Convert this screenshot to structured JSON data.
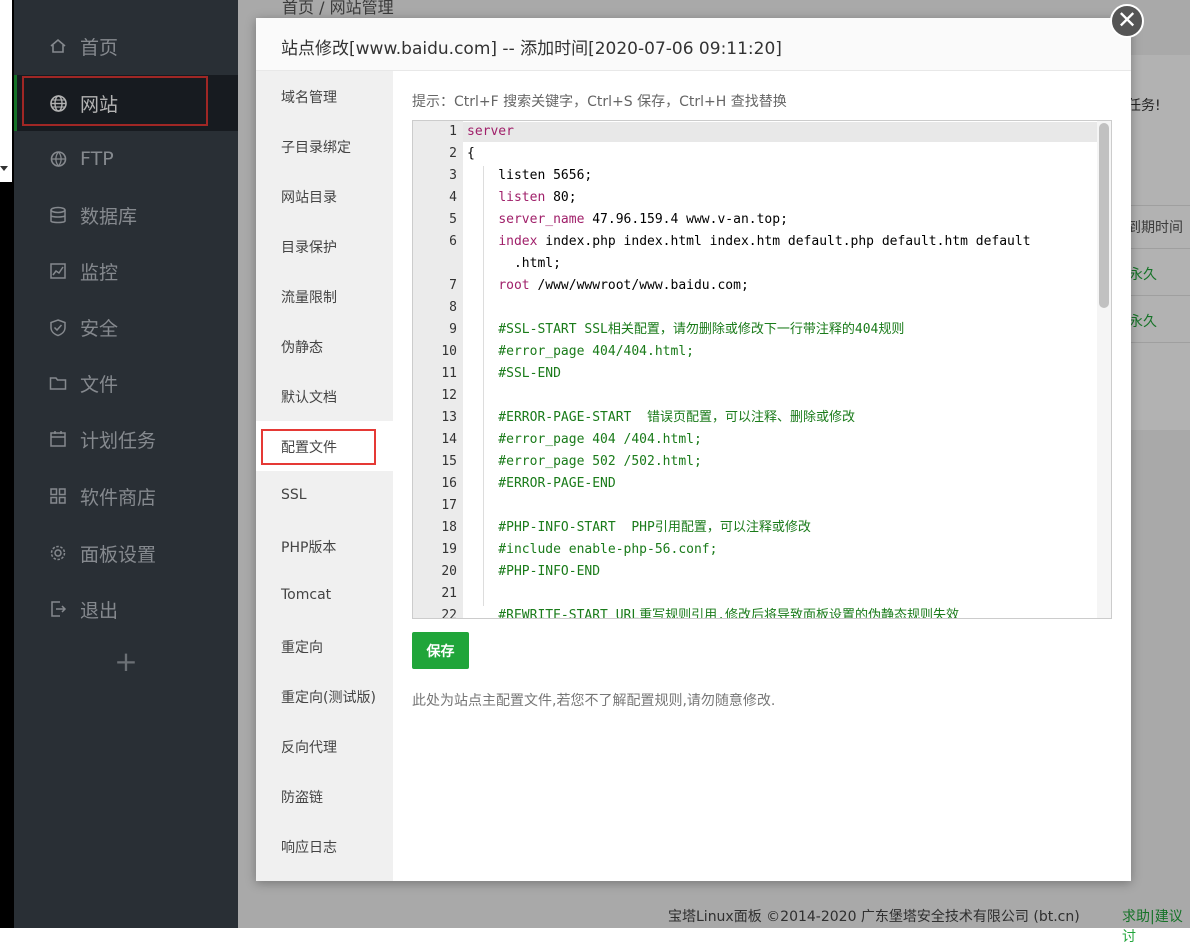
{
  "sidebar": {
    "items": [
      {
        "label": "首页",
        "icon": "home-icon"
      },
      {
        "label": "网站",
        "icon": "globe-icon",
        "active": true
      },
      {
        "label": "FTP",
        "icon": "ftp-icon"
      },
      {
        "label": "数据库",
        "icon": "database-icon"
      },
      {
        "label": "监控",
        "icon": "monitor-icon"
      },
      {
        "label": "安全",
        "icon": "shield-icon"
      },
      {
        "label": "文件",
        "icon": "folder-icon"
      },
      {
        "label": "计划任务",
        "icon": "calendar-icon"
      },
      {
        "label": "软件商店",
        "icon": "grid-icon"
      },
      {
        "label": "面板设置",
        "icon": "gear-icon"
      },
      {
        "label": "退出",
        "icon": "logout-icon"
      }
    ],
    "add_label": "+"
  },
  "background": {
    "breadcrumb": "首页 / 网站管理",
    "task_text": "任务!",
    "expire_header": "到期时间",
    "row1_expire": "永久",
    "row2_expire": "永久"
  },
  "modal": {
    "title": "站点修改[www.baidu.com] -- 添加时间[2020-07-06 09:11:20]",
    "close_label": "✕",
    "tabs": [
      "域名管理",
      "子目录绑定",
      "网站目录",
      "目录保护",
      "流量限制",
      "伪静态",
      "默认文档",
      "配置文件",
      "SSL",
      "PHP版本",
      "Tomcat",
      "重定向",
      "重定向(测试版)",
      "反向代理",
      "防盗链",
      "响应日志"
    ],
    "active_tab_index": 7,
    "tip": "提示：Ctrl+F 搜索关键字，Ctrl+S 保存，Ctrl+H 查找替换",
    "save_label": "保存",
    "note": "此处为站点主配置文件,若您不了解配置规则,请勿随意修改."
  },
  "editor": {
    "lines": [
      {
        "n": "1",
        "parts": [
          {
            "t": "server",
            "c": "kw"
          }
        ]
      },
      {
        "n": "2",
        "parts": [
          {
            "t": "{",
            "c": ""
          }
        ]
      },
      {
        "n": "3",
        "parts": [
          {
            "t": "    listen 5656;",
            "c": ""
          }
        ]
      },
      {
        "n": "4",
        "parts": [
          {
            "t": "    ",
            "c": ""
          },
          {
            "t": "listen",
            "c": "kw"
          },
          {
            "t": " 80;",
            "c": ""
          }
        ]
      },
      {
        "n": "5",
        "parts": [
          {
            "t": "    ",
            "c": ""
          },
          {
            "t": "server_name",
            "c": "kw"
          },
          {
            "t": " 47.96.159.4 www.v-an.top;",
            "c": ""
          }
        ]
      },
      {
        "n": "6",
        "parts": [
          {
            "t": "    ",
            "c": ""
          },
          {
            "t": "index",
            "c": "kw"
          },
          {
            "t": " index.php index.html index.htm default.php default.htm default",
            "c": ""
          }
        ]
      },
      {
        "n": "",
        "parts": [
          {
            "t": "      .html;",
            "c": ""
          }
        ]
      },
      {
        "n": "7",
        "parts": [
          {
            "t": "    ",
            "c": ""
          },
          {
            "t": "root",
            "c": "kw"
          },
          {
            "t": " /www/wwwroot/www.baidu.com;",
            "c": ""
          }
        ]
      },
      {
        "n": "8",
        "parts": [
          {
            "t": "",
            "c": ""
          }
        ]
      },
      {
        "n": "9",
        "parts": [
          {
            "t": "    #SSL-START SSL相关配置，请勿删除或修改下一行带注释的404规则",
            "c": "cm"
          }
        ]
      },
      {
        "n": "10",
        "parts": [
          {
            "t": "    #error_page 404/404.html;",
            "c": "cm"
          }
        ]
      },
      {
        "n": "11",
        "parts": [
          {
            "t": "    #SSL-END",
            "c": "cm"
          }
        ]
      },
      {
        "n": "12",
        "parts": [
          {
            "t": "",
            "c": ""
          }
        ]
      },
      {
        "n": "13",
        "parts": [
          {
            "t": "    #ERROR-PAGE-START  错误页配置，可以注释、删除或修改",
            "c": "cm"
          }
        ]
      },
      {
        "n": "14",
        "parts": [
          {
            "t": "    #error_page 404 /404.html;",
            "c": "cm"
          }
        ]
      },
      {
        "n": "15",
        "parts": [
          {
            "t": "    #error_page 502 /502.html;",
            "c": "cm"
          }
        ]
      },
      {
        "n": "16",
        "parts": [
          {
            "t": "    #ERROR-PAGE-END",
            "c": "cm"
          }
        ]
      },
      {
        "n": "17",
        "parts": [
          {
            "t": "",
            "c": ""
          }
        ]
      },
      {
        "n": "18",
        "parts": [
          {
            "t": "    #PHP-INFO-START  PHP引用配置，可以注释或修改",
            "c": "cm"
          }
        ]
      },
      {
        "n": "19",
        "parts": [
          {
            "t": "    #include enable-php-56.conf;",
            "c": "cm"
          }
        ]
      },
      {
        "n": "20",
        "parts": [
          {
            "t": "    #PHP-INFO-END",
            "c": "cm"
          }
        ]
      },
      {
        "n": "21",
        "parts": [
          {
            "t": "",
            "c": ""
          }
        ]
      },
      {
        "n": "22",
        "parts": [
          {
            "t": "    #REWRITE-START URL重写规则引用,修改后将导致面板设置的伪静态规则失效",
            "c": "cm"
          }
        ]
      }
    ]
  },
  "footer": {
    "copyright": "宝塔Linux面板 ©2014-2020 广东堡塔安全技术有限公司 (bt.cn)",
    "links": "求助|建议讨"
  },
  "colors": {
    "accent": "#20a53a",
    "sidebar_bg": "#3c444d",
    "highlight_red": "#e53935"
  }
}
